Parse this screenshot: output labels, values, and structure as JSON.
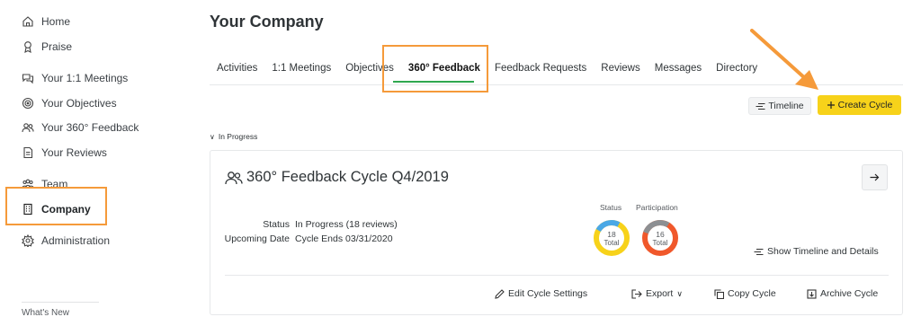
{
  "sidebar": {
    "items": [
      {
        "label": "Home",
        "icon": "home-icon"
      },
      {
        "label": "Praise",
        "icon": "ribbon-icon"
      },
      {
        "label": "Your 1:1 Meetings",
        "icon": "chat-bubbles-icon"
      },
      {
        "label": "Your Objectives",
        "icon": "target-icon"
      },
      {
        "label": "Your 360° Feedback",
        "icon": "people-icon"
      },
      {
        "label": "Your Reviews",
        "icon": "document-icon"
      },
      {
        "label": "Team",
        "icon": "team-icon"
      },
      {
        "label": "Company",
        "icon": "building-icon"
      },
      {
        "label": "Administration",
        "icon": "gear-icon"
      }
    ],
    "whats_new": "What's New"
  },
  "header": {
    "title": "Your Company"
  },
  "tabs": [
    {
      "label": "Activities"
    },
    {
      "label": "1:1 Meetings"
    },
    {
      "label": "Objectives"
    },
    {
      "label": "360° Feedback"
    },
    {
      "label": "Feedback Requests"
    },
    {
      "label": "Reviews"
    },
    {
      "label": "Messages"
    },
    {
      "label": "Directory"
    }
  ],
  "toolbar": {
    "timeline_label": "Timeline",
    "create_label": "Create Cycle",
    "create_color": "#f7d21a"
  },
  "section": {
    "label": "In Progress"
  },
  "cycle_card": {
    "title": "360° Feedback Cycle Q4/2019",
    "status_key": "Status",
    "status_value": "In Progress (18 reviews)",
    "date_key": "Upcoming Date",
    "date_value": "Cycle Ends 03/31/2020",
    "status_chart": {
      "label": "Status",
      "total": "18",
      "total_label": "Total",
      "colors": [
        "#4aa8e6",
        "#f7d21a"
      ]
    },
    "participation_chart": {
      "label": "Participation",
      "total": "16",
      "total_label": "Total",
      "colors": [
        "#8d8f92",
        "#f0582b"
      ]
    },
    "show_timeline_label": "Show Timeline and Details",
    "actions": {
      "edit": "Edit Cycle Settings",
      "export": "Export",
      "copy": "Copy Cycle",
      "archive": "Archive Cycle"
    }
  },
  "colors": {
    "highlight": "#f59a3a",
    "active_tab": "#2fa84f"
  }
}
